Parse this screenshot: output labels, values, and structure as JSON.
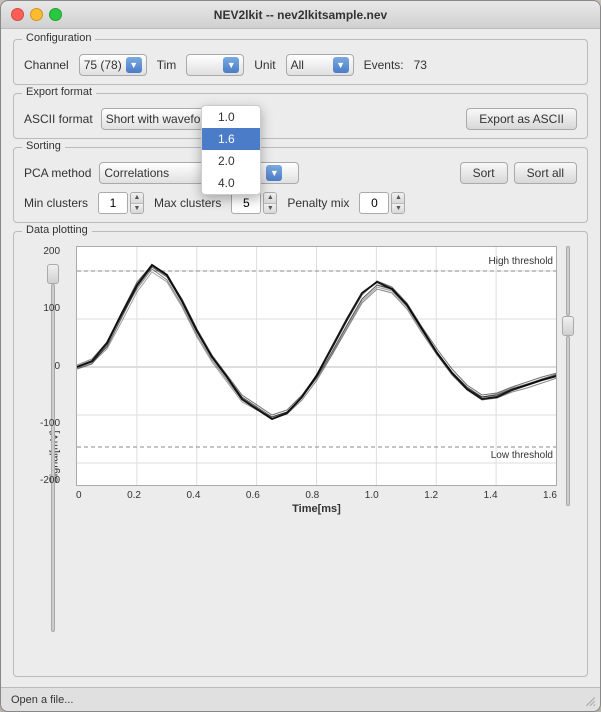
{
  "window": {
    "title": "NEV2lkit -- nev2lkitsample.nev"
  },
  "configuration": {
    "label": "Configuration",
    "channel_label": "Channel",
    "channel_value": "75 (78)",
    "time_label": "Tim",
    "unit_label": "Unit",
    "unit_value": "All",
    "events_label": "Events:",
    "events_value": "73"
  },
  "dropdown": {
    "items": [
      "1.0",
      "1.6",
      "2.0",
      "4.0"
    ],
    "selected": "1.6"
  },
  "export": {
    "label": "Export format",
    "format_label": "ASCII format",
    "format_value": "Short with wavefo",
    "button_label": "Export as ASCII"
  },
  "sorting": {
    "label": "Sorting",
    "pca_label": "PCA method",
    "pca_value": "Correlations",
    "sort_button": "Sort",
    "sort_all_button": "Sort all",
    "min_clusters_label": "Min clusters",
    "min_clusters_value": "1",
    "max_clusters_label": "Max clusters",
    "max_clusters_value": "5",
    "penalty_label": "Penalty mix",
    "penalty_value": "0"
  },
  "plot": {
    "label": "Data plotting",
    "y_axis_label": "Signal[mV]",
    "x_axis_label": "Time[ms]",
    "y_ticks": [
      "200",
      "100",
      "0",
      "-100",
      "-200"
    ],
    "x_ticks": [
      "0",
      "0.2",
      "0.4",
      "0.6",
      "0.8",
      "1.0",
      "1.2",
      "1.4",
      "1.6"
    ],
    "high_threshold": "High threshold",
    "low_threshold": "Low threshold"
  },
  "statusbar": {
    "text": "Open a file..."
  }
}
